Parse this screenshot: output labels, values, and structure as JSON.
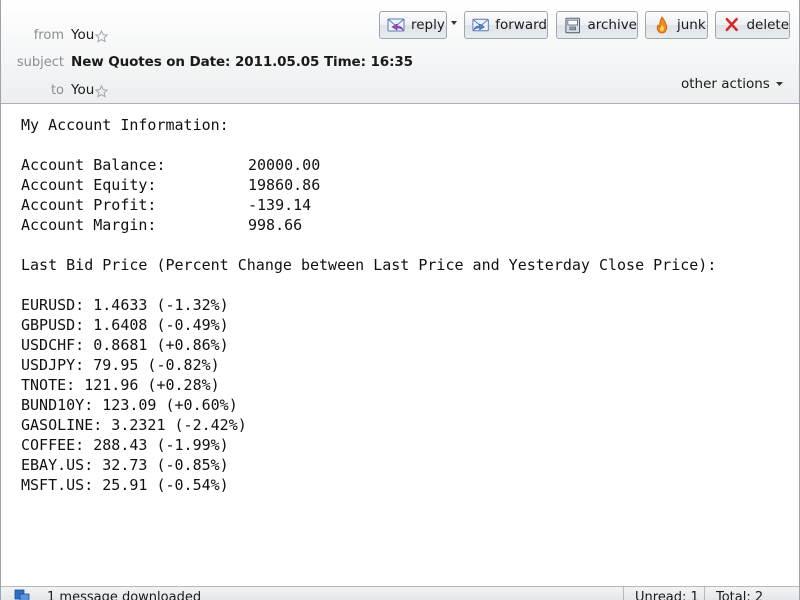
{
  "header": {
    "from_label": "from",
    "from_value": "You",
    "subject_label": "subject",
    "subject_value": "New Quotes on Date: 2011.05.05 Time: 16:35",
    "to_label": "to",
    "to_value": "You"
  },
  "toolbar": {
    "reply": "reply",
    "forward": "forward",
    "archive": "archive",
    "junk": "junk",
    "delete": "delete",
    "other_actions": "other actions"
  },
  "body": {
    "title": "My Account Information:",
    "account": [
      {
        "label": "Account Balance:",
        "value": "20000.00"
      },
      {
        "label": "Account Equity:",
        "value": "19860.86"
      },
      {
        "label": "Account Profit:",
        "value": "-139.14"
      },
      {
        "label": "Account Margin:",
        "value": "998.66"
      }
    ],
    "prices_heading": "Last Bid Price (Percent Change between Last Price and Yesterday Close Price):",
    "quotes": [
      "EURUSD: 1.4633 (-1.32%)",
      "GBPUSD: 1.6408 (-0.49%)",
      "USDCHF: 0.8681 (+0.86%)",
      "USDJPY: 79.95 (-0.82%)",
      "TNOTE: 121.96 (+0.28%)",
      "BUND10Y: 123.09 (+0.60%)",
      "GASOLINE: 3.2321 (-2.42%)",
      "COFFEE: 288.43 (-1.99%)",
      "EBAY.US: 32.73 (-0.85%)",
      "MSFT.US: 25.91 (-0.54%)"
    ]
  },
  "status": {
    "message": "1 message downloaded",
    "unread": "Unread: 1",
    "total": "Total: 2"
  },
  "icons": {
    "reply": "reply-envelope-icon",
    "forward": "forward-envelope-icon",
    "archive": "archive-box-icon",
    "junk": "junk-flame-icon",
    "delete": "delete-x-icon",
    "star": "star-outline-icon",
    "status": "activity-icon"
  },
  "colors": {
    "delete_red": "#d62a2a",
    "junk_orange": "#f08a1c",
    "envelope_blue": "#5a78b8",
    "label_gray": "#8a8f96"
  }
}
